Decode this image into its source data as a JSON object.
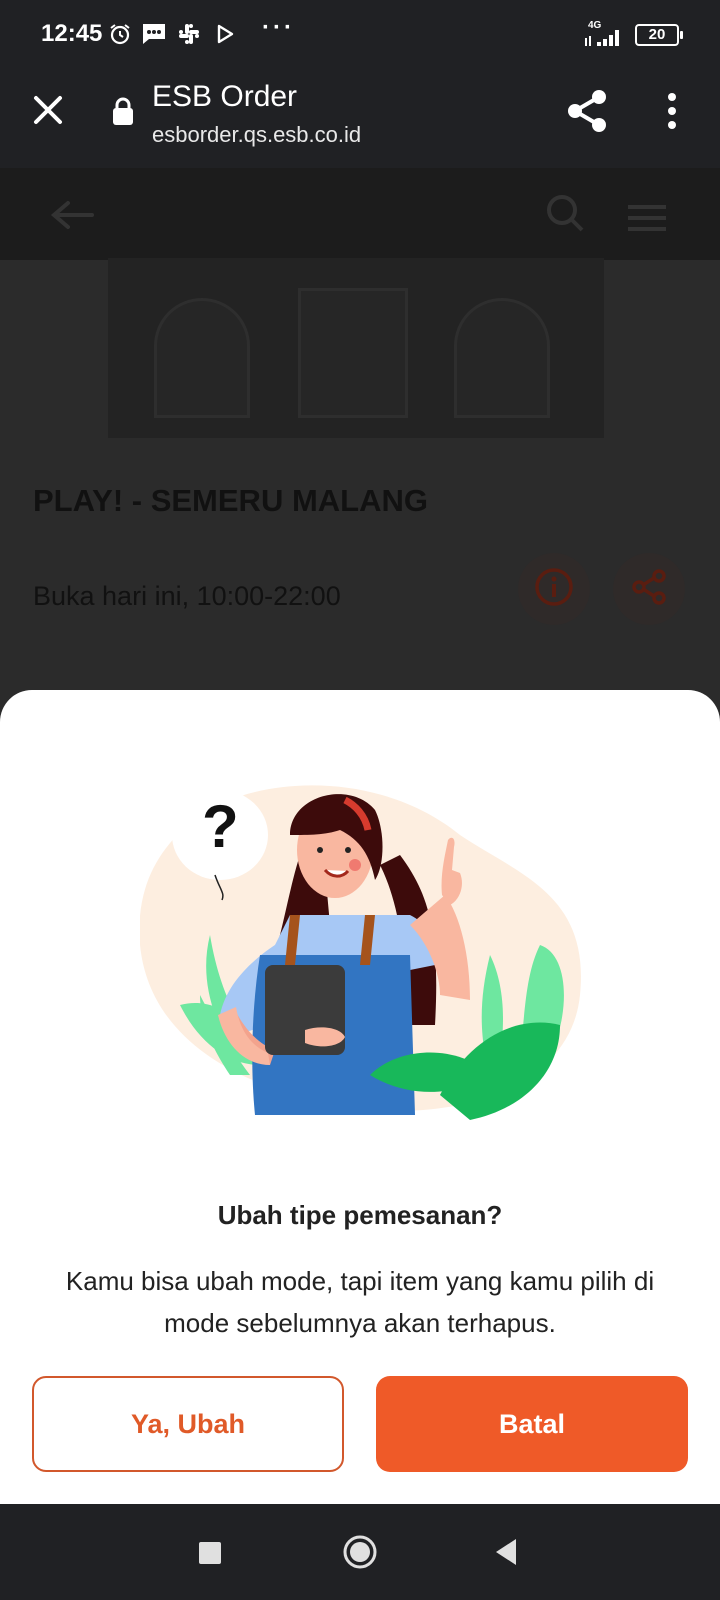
{
  "status_bar": {
    "time": "12:45",
    "network": "4G",
    "battery": "20",
    "icons": [
      "alarm-icon",
      "message-icon",
      "slack-icon",
      "play-store-icon",
      "more-dots-icon",
      "signal-icon",
      "battery-icon"
    ]
  },
  "browser": {
    "title": "ESB Order",
    "url": "esborder.qs.esb.co.id",
    "icons": [
      "close-icon",
      "lock-icon",
      "share-icon",
      "overflow-menu-icon"
    ]
  },
  "page": {
    "store_name": "PLAY! - SEMERU MALANG",
    "hours": "Buka hari ini, 10:00-22:00",
    "icons": [
      "back-arrow-icon",
      "search-icon",
      "hamburger-menu-icon",
      "info-icon",
      "share-icon"
    ]
  },
  "dialog": {
    "title": "Ubah tipe pemesanan?",
    "message": "Kamu bisa ubah mode, tapi item yang kamu pilih di mode sebelumnya akan terhapus.",
    "confirm_label": "Ya, Ubah",
    "cancel_label": "Batal",
    "illustration_glyph": "?"
  },
  "colors": {
    "accent": "#EF5A28",
    "system_bar": "#202124"
  },
  "navbar": {
    "icons": [
      "recents-icon",
      "home-icon",
      "back-icon"
    ]
  }
}
